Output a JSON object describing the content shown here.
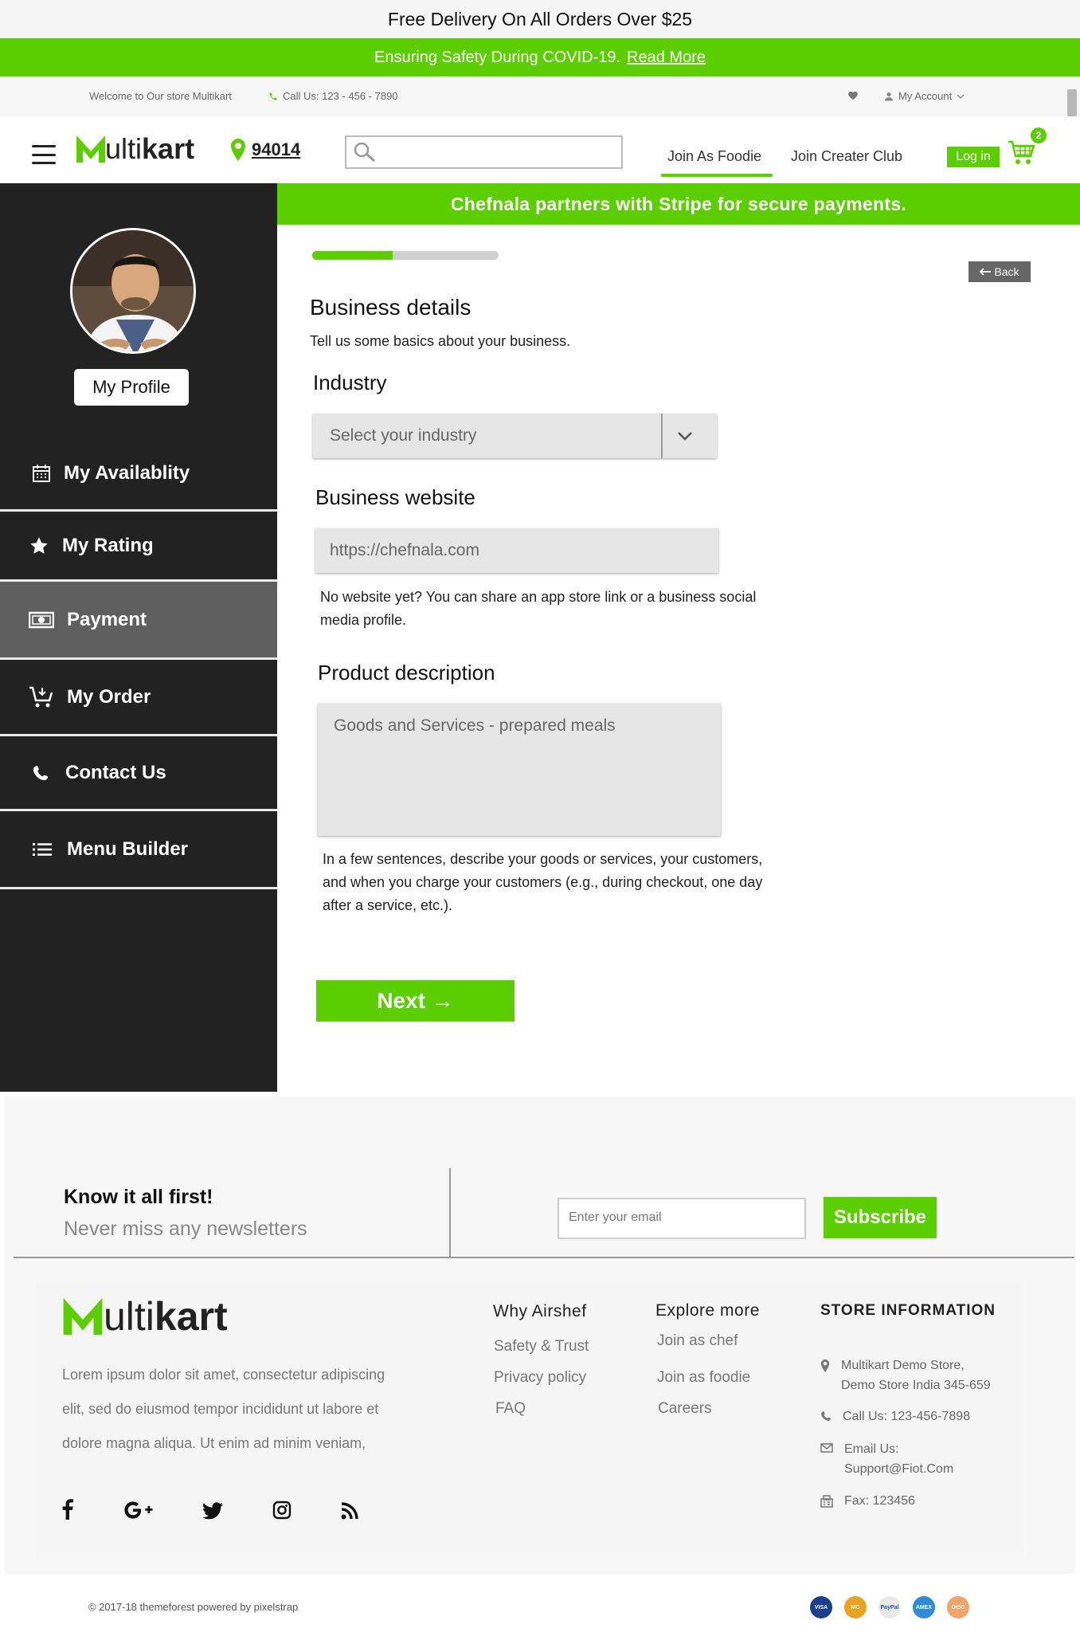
{
  "top_banner": {
    "text": "Free Delivery On All Orders Over $25"
  },
  "covid_banner": {
    "text": "Ensuring Safety During COVID-19.",
    "link": "Read More"
  },
  "info_bar": {
    "welcome": "Welcome to Our store Multikart",
    "phone": "Call Us: 123 - 456 - 7890",
    "account": "My Account"
  },
  "header": {
    "logo_prefix": "ulti",
    "logo_bold": "kart",
    "zip": "94014",
    "search_placeholder": "",
    "nav": [
      {
        "label": "Join As Foodie",
        "active": true
      },
      {
        "label": "Join Creater Club",
        "active": false
      }
    ],
    "login": "Log in",
    "cart_count": "2"
  },
  "sidebar": {
    "profile_button": "My Profile",
    "items": [
      {
        "label": "My Availablity",
        "icon": "calendar-icon"
      },
      {
        "label": "My Rating",
        "icon": "star-icon"
      },
      {
        "label": "Payment",
        "icon": "money-icon",
        "active": true
      },
      {
        "label": "My Order",
        "icon": "cart-icon"
      },
      {
        "label": "Contact Us",
        "icon": "phone-icon"
      },
      {
        "label": "Menu Builder",
        "icon": "list-icon"
      }
    ]
  },
  "main": {
    "stripe_notice": "Chefnala partners with Stripe for secure payments.",
    "progress_fraction": 0.43,
    "back": "Back",
    "title": "Business details",
    "subtitle": "Tell us some basics about your business.",
    "industry": {
      "label": "Industry",
      "value": "Select your industry"
    },
    "website": {
      "label": "Business website",
      "value": "https://chefnala.com",
      "help_line1": "No website yet? You can share an app store link or a business social",
      "help_line2": "media profile."
    },
    "product": {
      "label": "Product description",
      "value": "Goods and Services - prepared meals",
      "help_line1": "In a few sentences, describe your goods or services, your customers,",
      "help_line2": "and when you charge your customers (e.g., during checkout, one day",
      "help_line3": "after a service, etc.)."
    },
    "next": "Next →"
  },
  "newsletter": {
    "title": "Know it all first!",
    "subtitle": "Never miss any newsletters",
    "email_placeholder": "Enter your email",
    "subscribe": "Subscribe"
  },
  "footer": {
    "logo_prefix": "ulti",
    "logo_bold": "kart",
    "about_line1": "Lorem ipsum dolor sit amet, consectetur adipiscing",
    "about_line2": "elit, sed do eiusmod tempor incididunt ut labore et",
    "about_line3": "dolore magna aliqua. Ut enim ad minim veniam,",
    "why_title": "Why Airshef",
    "why_links": [
      "Safety & Trust",
      "Privacy policy",
      "FAQ"
    ],
    "explore_title": "Explore more",
    "explore_links": [
      "Join as chef",
      "Join as foodie",
      "Careers"
    ],
    "store_title": "STORE INFORMATION",
    "store_address_1": "Multikart Demo Store,",
    "store_address_2": "Demo Store India 345-659",
    "store_phone": "Call Us: 123-456-7898",
    "store_email_label": "Email Us:",
    "store_email": "Support@Fiot.Com",
    "store_fax": "Fax: 123456"
  },
  "copyright": "© 2017-18 themeforest powered by pixelstrap",
  "payment_icons": [
    "VISA",
    "MC",
    "PayPal",
    "AMEX",
    "DISC"
  ],
  "colors": {
    "accent": "#5cce00",
    "sidebar": "#222222",
    "active_item": "#5f5f5f"
  }
}
